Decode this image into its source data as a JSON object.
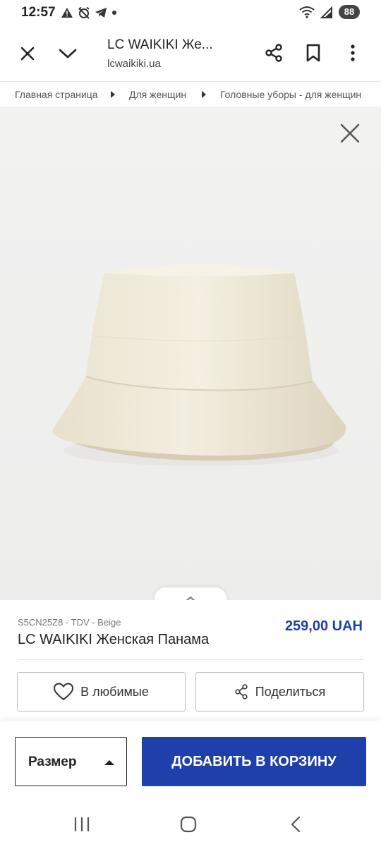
{
  "status_bar": {
    "time": "12:57",
    "battery": "88",
    "icons": [
      "warning-icon",
      "alarm-off-icon",
      "telegram-icon",
      "dot-icon",
      "wifi-icon",
      "signal-icon"
    ]
  },
  "browser": {
    "title": "LC WAIKIKI Же...",
    "url": "lcwaikiki.ua",
    "icons": [
      "close-icon",
      "chevron-down-icon",
      "share-icon",
      "bookmark-icon",
      "more-vert-icon"
    ]
  },
  "breadcrumb": {
    "items": [
      "Главная страница",
      "Для женщин",
      "Головные уборы - для женщин"
    ]
  },
  "product": {
    "sku": "S5CN25Z8 - TDV - Beige",
    "name": "LC WAIKIKI Женская Панама",
    "price": "259,00 UAH",
    "favorite_label": "В любимые",
    "share_label": "Поделиться"
  },
  "purchase": {
    "size_label": "Размер",
    "add_to_cart_label": "ДОБАВИТЬ В КОРЗИНУ"
  },
  "colors": {
    "accent": "#1f3faa",
    "price": "#1f3f9e",
    "hat": "#efe9d8",
    "image_background": "#f0f0ef"
  }
}
